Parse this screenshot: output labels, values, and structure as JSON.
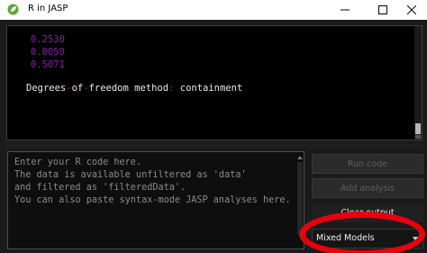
{
  "window": {
    "title": "R in JASP",
    "app_icon": "jasp-leaf-icon",
    "controls": [
      "minimize-icon",
      "maximize-icon",
      "close-icon"
    ]
  },
  "output": {
    "values": [
      "0.2530",
      "0.0050",
      "0.5071"
    ],
    "df_line": {
      "part1": "Degrees",
      "dash1": "-",
      "part2": "of",
      "dash2": "-",
      "part3": "freedom method",
      "colon": ":",
      "part4": " containment"
    }
  },
  "editor": {
    "placeholder_lines": [
      "Enter your R code here.",
      "The data is available unfiltered as 'data'",
      "and filtered as 'filteredData'.",
      "You can also paste syntax-mode JASP analyses here."
    ]
  },
  "buttons": {
    "run": "Run code",
    "add": "Add analysis",
    "clear": "Clear output"
  },
  "module_select": {
    "selected": "Mixed Models"
  },
  "colors": {
    "numeric_output": "#8a1ea8",
    "annotation_ring": "#e8000f"
  }
}
